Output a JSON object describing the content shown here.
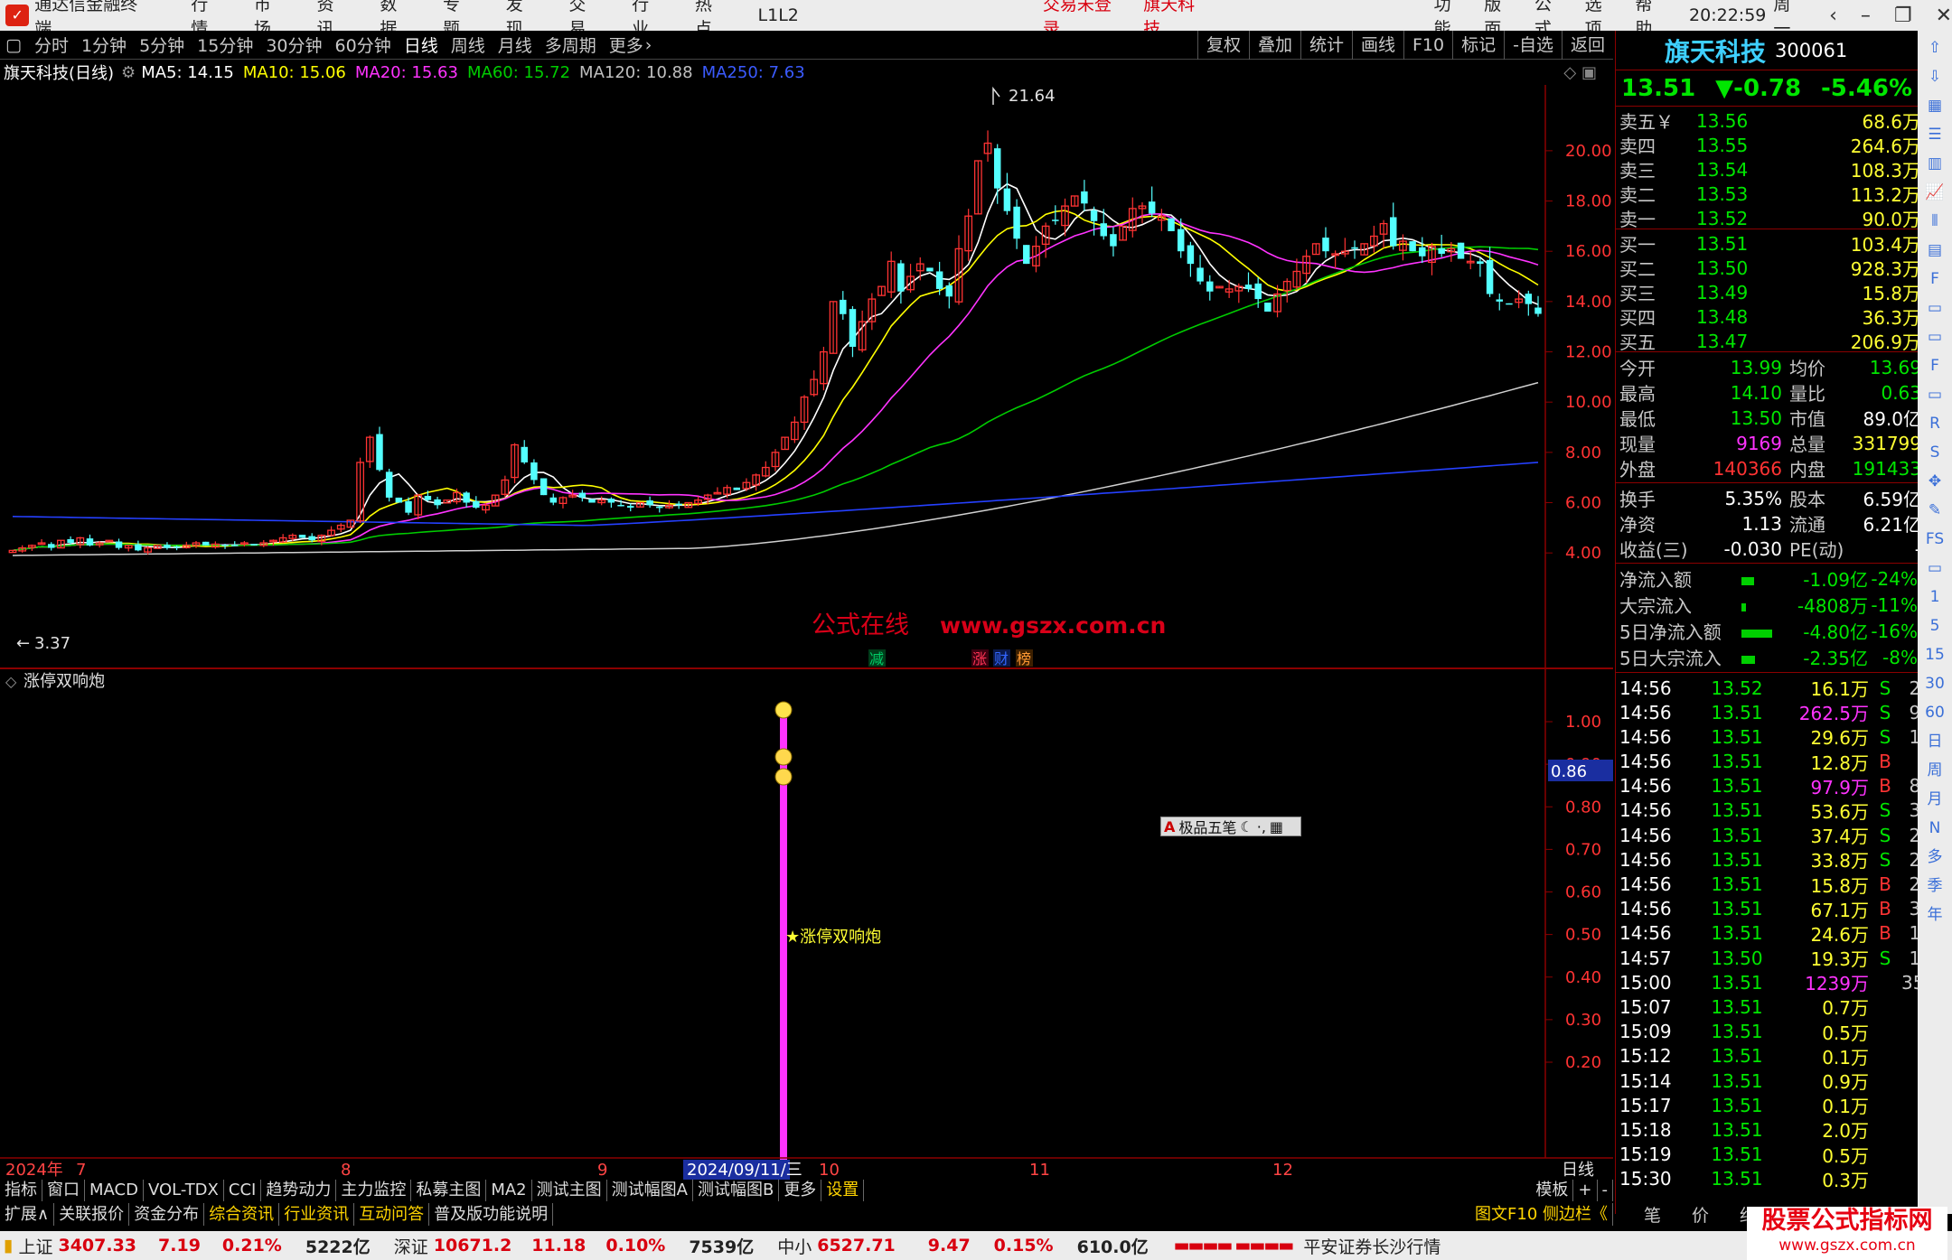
{
  "menubar": {
    "app_title": "通达信金融终端",
    "items": [
      "行情",
      "市场",
      "资讯",
      "数据",
      "专题",
      "发现",
      "交易",
      "行业",
      "热点",
      "L1L2"
    ],
    "login_status": "交易未登录",
    "stock_name": "旗天科技",
    "right_items": [
      "功能",
      "版面",
      "公式",
      "选项",
      "帮助"
    ],
    "time": "20:22:59",
    "weekday": "周一"
  },
  "periods": {
    "items": [
      "分时",
      "1分钟",
      "5分钟",
      "15分钟",
      "30分钟",
      "60分钟",
      "日线",
      "周线",
      "月线",
      "多周期",
      "更多"
    ],
    "active": "日线",
    "tools": [
      "复权",
      "叠加",
      "统计",
      "画线",
      "F10",
      "标记",
      "-自选",
      "返回"
    ]
  },
  "ma_bar": {
    "title": "旗天科技(日线)",
    "items": [
      {
        "label": "MA5: 14.15",
        "color": "#ffffff"
      },
      {
        "label": "MA10: 15.06",
        "color": "#ffff00"
      },
      {
        "label": "MA20: 15.63",
        "color": "#ff33ff"
      },
      {
        "label": "MA60: 15.72",
        "color": "#00cc00"
      },
      {
        "label": "MA120: 10.88",
        "color": "#c0c0c0"
      },
      {
        "label": "MA250: 7.63",
        "color": "#3b5bff"
      }
    ]
  },
  "main_chart": {
    "high_label": "21.64",
    "low_label": "3.37",
    "y_ticks": [
      "20.00",
      "18.00",
      "16.00",
      "14.00",
      "12.00",
      "10.00",
      "8.00",
      "6.00",
      "4.00"
    ],
    "watermark_text": "公式在线",
    "watermark_url": "www.gszx.com.cn",
    "markers": [
      {
        "text": "减",
        "color": "#00cc66"
      },
      {
        "text": "涨",
        "color": "#ff3355"
      },
      {
        "text": "财",
        "color": "#3366ff"
      },
      {
        "text": "榜",
        "color": "#ff9933"
      }
    ]
  },
  "indicator": {
    "title": "涨停双响炮",
    "y_ticks": [
      "1.00",
      "0.90",
      "0.80",
      "0.70",
      "0.60",
      "0.50",
      "0.40",
      "0.30",
      "0.20"
    ],
    "current_value": "0.86",
    "signal_label": "★涨停双响炮",
    "signal_value": 1.0
  },
  "float_tool": {
    "label": "极品五笔"
  },
  "date_axis": {
    "year": "2024年",
    "months": [
      "7",
      "8",
      "9",
      "10",
      "11",
      "12"
    ],
    "cursor_date": "2024/09/11/三",
    "period_label": "日线"
  },
  "quote": {
    "name": "旗天科技",
    "code": "300061",
    "price": "13.51",
    "change": "▼-0.78",
    "pct": "-5.46%",
    "asks": [
      {
        "label": "卖五￥",
        "price": "13.56",
        "vol": "68.6万"
      },
      {
        "label": "卖四",
        "price": "13.55",
        "vol": "264.6万"
      },
      {
        "label": "卖三",
        "price": "13.54",
        "vol": "108.3万"
      },
      {
        "label": "卖二",
        "price": "13.53",
        "vol": "113.2万"
      },
      {
        "label": "卖一",
        "price": "13.52",
        "vol": "90.0万"
      }
    ],
    "bids": [
      {
        "label": "买一",
        "price": "13.51",
        "vol": "103.4万"
      },
      {
        "label": "买二",
        "price": "13.50",
        "vol": "928.3万"
      },
      {
        "label": "买三",
        "price": "13.49",
        "vol": "15.8万"
      },
      {
        "label": "买四",
        "price": "13.48",
        "vol": "36.3万"
      },
      {
        "label": "买五",
        "price": "13.47",
        "vol": "206.9万"
      }
    ],
    "stats1": [
      {
        "k1": "今开",
        "v1": "13.99",
        "c1": "#00e600",
        "k2": "均价",
        "v2": "13.69",
        "c2": "#00e600"
      },
      {
        "k1": "最高",
        "v1": "14.10",
        "c1": "#00e600",
        "k2": "量比",
        "v2": "0.63",
        "c2": "#00e600"
      },
      {
        "k1": "最低",
        "v1": "13.50",
        "c1": "#00e600",
        "k2": "市值",
        "v2": "89.0亿",
        "c2": "#ffffff"
      },
      {
        "k1": "现量",
        "v1": "9169",
        "c1": "#ff33ff",
        "k2": "总量",
        "v2": "331799",
        "c2": "#ffff33"
      },
      {
        "k1": "外盘",
        "v1": "140366",
        "c1": "#ff3333",
        "k2": "内盘",
        "v2": "191433",
        "c2": "#00e600"
      }
    ],
    "stats2": [
      {
        "k1": "换手",
        "v1": "5.35%",
        "k2": "股本",
        "v2": "6.59亿"
      },
      {
        "k1": "净资",
        "v1": "1.13",
        "k2": "流通",
        "v2": "6.21亿"
      },
      {
        "k1": "收益(三)",
        "v1": "-0.030",
        "k2": "PE(动)",
        "v2": "-"
      }
    ],
    "flows": [
      {
        "label": "净流入额",
        "value": "-1.09亿",
        "pct": "-24%",
        "bar": 0.4
      },
      {
        "label": "大宗流入",
        "value": "-4808万",
        "pct": "-11%",
        "bar": 0.15
      },
      {
        "label": "5日净流入额",
        "value": "-4.80亿",
        "pct": "-16%",
        "bar": 1.0
      },
      {
        "label": "5日大宗流入",
        "value": "-2.35亿",
        "pct": "-8%",
        "bar": 0.45
      }
    ],
    "ticks": [
      {
        "t": "14:56",
        "p": "13.52",
        "v": "16.1万",
        "bs": "S",
        "n": "21",
        "m": false
      },
      {
        "t": "14:56",
        "p": "13.51",
        "v": "262.5万",
        "bs": "S",
        "n": "96",
        "m": true
      },
      {
        "t": "14:56",
        "p": "13.51",
        "v": "29.6万",
        "bs": "S",
        "n": "14",
        "m": false
      },
      {
        "t": "14:56",
        "p": "13.51",
        "v": "12.8万",
        "bs": "B",
        "n": "8",
        "m": false
      },
      {
        "t": "14:56",
        "p": "13.51",
        "v": "97.9万",
        "bs": "B",
        "n": "85",
        "m": true
      },
      {
        "t": "14:56",
        "p": "13.51",
        "v": "53.6万",
        "bs": "S",
        "n": "34",
        "m": false
      },
      {
        "t": "14:56",
        "p": "13.51",
        "v": "37.4万",
        "bs": "S",
        "n": "22",
        "m": false
      },
      {
        "t": "14:56",
        "p": "13.51",
        "v": "33.8万",
        "bs": "S",
        "n": "27",
        "m": false
      },
      {
        "t": "14:56",
        "p": "13.51",
        "v": "15.8万",
        "bs": "B",
        "n": "20",
        "m": false
      },
      {
        "t": "14:56",
        "p": "13.51",
        "v": "67.1万",
        "bs": "B",
        "n": "38",
        "m": false
      },
      {
        "t": "14:56",
        "p": "13.51",
        "v": "24.6万",
        "bs": "B",
        "n": "16",
        "m": false
      },
      {
        "t": "14:57",
        "p": "13.50",
        "v": "19.3万",
        "bs": "S",
        "n": "17",
        "m": false
      },
      {
        "t": "15:00",
        "p": "13.51",
        "v": "1239万",
        "bs": "",
        "n": "356",
        "m": true
      },
      {
        "t": "15:07",
        "p": "13.51",
        "v": "0.7万",
        "bs": "",
        "n": "1",
        "m": false
      },
      {
        "t": "15:09",
        "p": "13.51",
        "v": "0.5万",
        "bs": "",
        "n": "2",
        "m": false
      },
      {
        "t": "15:12",
        "p": "13.51",
        "v": "0.1万",
        "bs": "",
        "n": "1",
        "m": false
      },
      {
        "t": "15:14",
        "p": "13.51",
        "v": "0.9万",
        "bs": "",
        "n": "1",
        "m": false
      },
      {
        "t": "15:17",
        "p": "13.51",
        "v": "0.1万",
        "bs": "",
        "n": "1",
        "m": false
      },
      {
        "t": "15:18",
        "p": "13.51",
        "v": "2.0万",
        "bs": "",
        "n": "1",
        "m": false
      },
      {
        "t": "15:19",
        "p": "13.51",
        "v": "0.5万",
        "bs": "",
        "n": "1",
        "m": false
      },
      {
        "t": "15:30",
        "p": "13.51",
        "v": "0.3万",
        "bs": "",
        "n": "1",
        "m": false
      }
    ]
  },
  "side_icons": [
    "arrow-up",
    "arrow-down",
    "grid",
    "list",
    "bars",
    "chart",
    "candles",
    "table",
    "F10",
    "doc",
    "doc",
    "F",
    "doc",
    "RSI",
    "S",
    "move",
    "pen",
    "FS",
    "doc",
    "1",
    "5",
    "15",
    "30",
    "60",
    "日",
    "周",
    "月",
    "N",
    "多",
    "季",
    "年"
  ],
  "tabs1": [
    "指标",
    "窗口",
    "MACD",
    "VOL-TDX",
    "CCI",
    "趋势动力",
    "主力监控",
    "私募主图",
    "MA2",
    "测试主图",
    "测试幅图A",
    "测试幅图B",
    "更多",
    "设置"
  ],
  "tabs1_right": [
    "模板",
    "+",
    "-"
  ],
  "tabs2": [
    "扩展∧",
    "关联报价",
    "资金分布",
    "综合资讯",
    "行业资讯",
    "互动问答",
    "普及版功能说明"
  ],
  "tabs2_right": "图文F10 侧边栏《",
  "rtabs": [
    "笔",
    "价",
    "细",
    "盘"
  ],
  "statusbar": [
    {
      "name": "上证",
      "index": "3407.33",
      "chg": "7.19",
      "pct": "0.21%",
      "amt": "5222亿"
    },
    {
      "name": "深证",
      "index": "10671.2",
      "chg": "11.18",
      "pct": "0.10%",
      "amt": "7539亿"
    },
    {
      "name": "中小",
      "index": "6527.71",
      "chg": "9.47",
      "pct": "0.15%",
      "amt": "610.0亿"
    }
  ],
  "status_broker": "平安证券长沙行情",
  "watermark": {
    "title": "股票公式指标网",
    "url": "www.gszx.com.cn"
  }
}
